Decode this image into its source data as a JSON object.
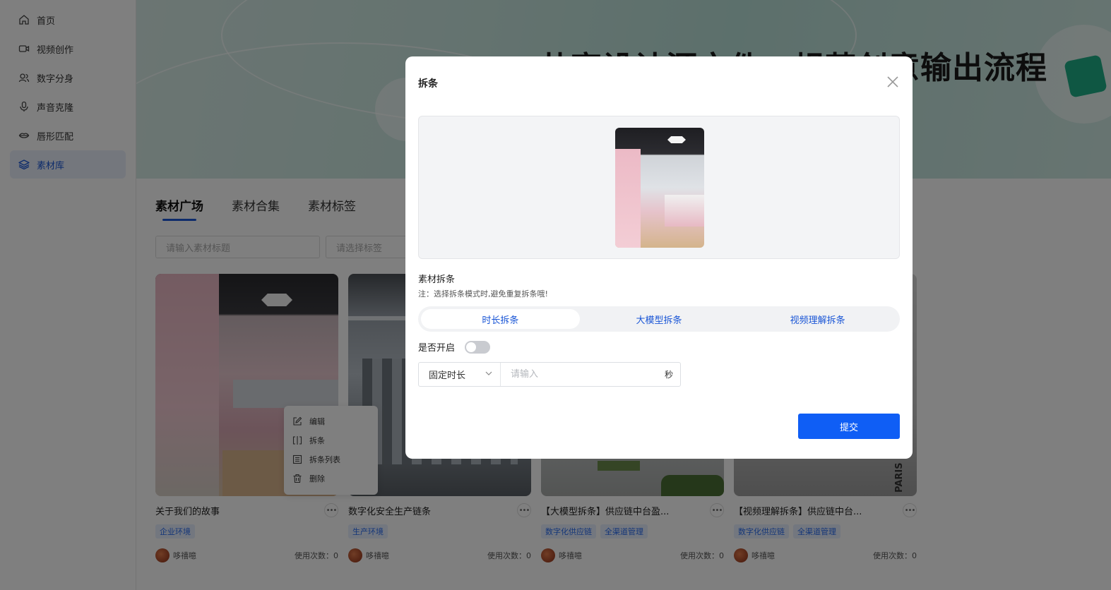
{
  "sidebar": {
    "items": [
      {
        "label": "首页",
        "icon": "home-icon"
      },
      {
        "label": "视频创作",
        "icon": "video-icon"
      },
      {
        "label": "数字分身",
        "icon": "users-icon"
      },
      {
        "label": "声音克隆",
        "icon": "mic-icon"
      },
      {
        "label": "唇形匹配",
        "icon": "lips-icon"
      },
      {
        "label": "素材库",
        "icon": "layers-icon",
        "active": true
      }
    ]
  },
  "banner": {
    "title": "共享设计源文件，规范创意输出流程"
  },
  "tabs": [
    {
      "label": "素材广场",
      "active": true
    },
    {
      "label": "素材合集"
    },
    {
      "label": "素材标签"
    }
  ],
  "filters": {
    "title_placeholder": "请输入素材标题",
    "tag_placeholder": "请选择标签"
  },
  "cards": [
    {
      "title": "关于我们的故事",
      "tags": [
        "企业环境"
      ],
      "author": "哆禧噫",
      "usage": "使用次数：0"
    },
    {
      "title": "数字化安全生产链条",
      "tags": [
        "生产环境"
      ],
      "author": "哆禧噫",
      "usage": "使用次数：0"
    },
    {
      "title": "【大模型拆条】供应链中台盈...",
      "tags": [
        "数字化供应链",
        "全渠道管理"
      ],
      "author": "哆禧噫",
      "usage": "使用次数：0"
    },
    {
      "title": "【视频理解拆条】供应链中台...",
      "tags": [
        "数字化供应链",
        "全渠道管理"
      ],
      "author": "哆禧噫",
      "usage": "使用次数：0"
    }
  ],
  "context_menu": {
    "items": [
      {
        "label": "编辑",
        "icon": "edit-icon"
      },
      {
        "label": "拆条",
        "icon": "split-icon"
      },
      {
        "label": "拆条列表",
        "icon": "list-icon"
      },
      {
        "label": "删除",
        "icon": "trash-icon"
      }
    ]
  },
  "modal": {
    "title": "拆条",
    "section_label": "素材拆条",
    "note": "注：选择拆条模式时,避免重复拆条哦!",
    "segments": [
      {
        "label": "时长拆条",
        "active": true
      },
      {
        "label": "大模型拆条"
      },
      {
        "label": "视频理解拆条"
      }
    ],
    "switch_label": "是否开启",
    "switch_on": false,
    "duration_select": "固定时长",
    "duration_placeholder": "请输入",
    "duration_unit": "秒",
    "submit_label": "提交"
  },
  "colors": {
    "accent": "#0f5ef5",
    "link": "#1a56d6",
    "tag_bg": "#e7efff",
    "overlay": "rgba(0,0,0,0.5)"
  }
}
